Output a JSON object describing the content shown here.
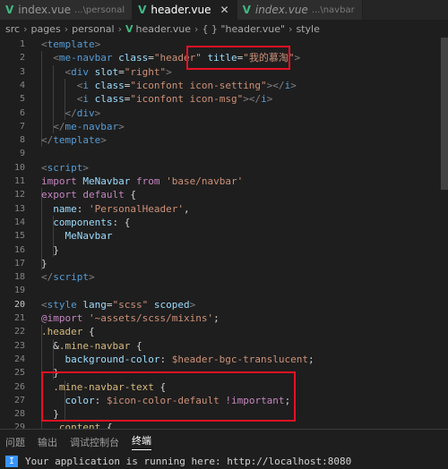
{
  "tabs": [
    {
      "name": "index.vue",
      "hint": "...\\personal",
      "active": false
    },
    {
      "name": "header.vue",
      "hint": "",
      "active": true,
      "close": "✕"
    },
    {
      "name": "index.vue",
      "hint": "...\\navbar",
      "active": false
    }
  ],
  "breadcrumb": [
    "src",
    "pages",
    "personal",
    "header.vue",
    "{ } \"header.vue\"",
    "style"
  ],
  "lines": [
    {
      "n": "1",
      "tokens": [
        [
          "t-punc",
          "<"
        ],
        [
          "t-tag",
          "template"
        ],
        [
          "t-punc",
          ">"
        ]
      ]
    },
    {
      "n": "2",
      "tokens": [
        [
          "t-punc",
          "  <"
        ],
        [
          "t-tag",
          "me-navbar"
        ],
        [
          "t-plain",
          " "
        ],
        [
          "t-attr",
          "class"
        ],
        [
          "t-plain",
          "="
        ],
        [
          "t-str",
          "\"header\""
        ],
        [
          "t-plain",
          " "
        ],
        [
          "t-attr",
          "title"
        ],
        [
          "t-plain",
          "="
        ],
        [
          "t-str",
          "\"我的慕淘\""
        ],
        [
          "t-punc",
          ">"
        ]
      ]
    },
    {
      "n": "3",
      "tokens": [
        [
          "t-punc",
          "    <"
        ],
        [
          "t-tag",
          "div"
        ],
        [
          "t-plain",
          " "
        ],
        [
          "t-attr",
          "slot"
        ],
        [
          "t-plain",
          "="
        ],
        [
          "t-str",
          "\"right\""
        ],
        [
          "t-punc",
          ">"
        ]
      ]
    },
    {
      "n": "4",
      "tokens": [
        [
          "t-punc",
          "      <"
        ],
        [
          "t-tag",
          "i"
        ],
        [
          "t-plain",
          " "
        ],
        [
          "t-attr",
          "class"
        ],
        [
          "t-plain",
          "="
        ],
        [
          "t-str",
          "\"iconfont icon-setting\""
        ],
        [
          "t-punc",
          "></"
        ],
        [
          "t-tag",
          "i"
        ],
        [
          "t-punc",
          ">"
        ]
      ]
    },
    {
      "n": "5",
      "tokens": [
        [
          "t-punc",
          "      <"
        ],
        [
          "t-tag",
          "i"
        ],
        [
          "t-plain",
          " "
        ],
        [
          "t-attr",
          "class"
        ],
        [
          "t-plain",
          "="
        ],
        [
          "t-str",
          "\"iconfont icon-msg\""
        ],
        [
          "t-punc",
          "></"
        ],
        [
          "t-tag",
          "i"
        ],
        [
          "t-punc",
          ">"
        ]
      ]
    },
    {
      "n": "6",
      "tokens": [
        [
          "t-punc",
          "    </"
        ],
        [
          "t-tag",
          "div"
        ],
        [
          "t-punc",
          ">"
        ]
      ]
    },
    {
      "n": "7",
      "tokens": [
        [
          "t-punc",
          "  </"
        ],
        [
          "t-tag",
          "me-navbar"
        ],
        [
          "t-punc",
          ">"
        ]
      ]
    },
    {
      "n": "8",
      "tokens": [
        [
          "t-punc",
          "</"
        ],
        [
          "t-tag",
          "template"
        ],
        [
          "t-punc",
          ">"
        ]
      ]
    },
    {
      "n": "9",
      "tokens": []
    },
    {
      "n": "10",
      "tokens": [
        [
          "t-punc",
          "<"
        ],
        [
          "t-tag",
          "script"
        ],
        [
          "t-punc",
          ">"
        ]
      ]
    },
    {
      "n": "11",
      "tokens": [
        [
          "t-kw",
          "import"
        ],
        [
          "t-plain",
          " "
        ],
        [
          "t-attr",
          "MeNavbar"
        ],
        [
          "t-plain",
          " "
        ],
        [
          "t-kw",
          "from"
        ],
        [
          "t-plain",
          " "
        ],
        [
          "t-str",
          "'base/navbar'"
        ]
      ]
    },
    {
      "n": "12",
      "tokens": [
        [
          "t-kw",
          "export"
        ],
        [
          "t-plain",
          " "
        ],
        [
          "t-kw",
          "default"
        ],
        [
          "t-plain",
          " {"
        ]
      ]
    },
    {
      "n": "13",
      "tokens": [
        [
          "t-prop",
          "  name"
        ],
        [
          "t-plain",
          ": "
        ],
        [
          "t-str",
          "'PersonalHeader'"
        ],
        [
          "t-plain",
          ","
        ]
      ]
    },
    {
      "n": "14",
      "tokens": [
        [
          "t-prop",
          "  components"
        ],
        [
          "t-plain",
          ": {"
        ]
      ]
    },
    {
      "n": "15",
      "tokens": [
        [
          "t-prop",
          "    MeNavbar"
        ]
      ]
    },
    {
      "n": "16",
      "tokens": [
        [
          "t-plain",
          "  }"
        ]
      ]
    },
    {
      "n": "17",
      "tokens": [
        [
          "t-plain",
          "}"
        ]
      ]
    },
    {
      "n": "18",
      "tokens": [
        [
          "t-punc",
          "</"
        ],
        [
          "t-tag",
          "script"
        ],
        [
          "t-punc",
          ">"
        ]
      ]
    },
    {
      "n": "19",
      "tokens": []
    },
    {
      "n": "20",
      "tokens": [
        [
          "t-punc",
          "<"
        ],
        [
          "t-tag",
          "style"
        ],
        [
          "t-plain",
          " "
        ],
        [
          "t-attr",
          "lang"
        ],
        [
          "t-plain",
          "="
        ],
        [
          "t-str",
          "\"scss\""
        ],
        [
          "t-plain",
          " "
        ],
        [
          "t-attr",
          "scoped"
        ],
        [
          "t-punc",
          ">"
        ]
      ]
    },
    {
      "n": "21",
      "tokens": [
        [
          "t-imp",
          "@import"
        ],
        [
          "t-plain",
          " "
        ],
        [
          "t-str",
          "'~assets/scss/mixins'"
        ],
        [
          "t-plain",
          ";"
        ]
      ]
    },
    {
      "n": "22",
      "tokens": [
        [
          "t-sel",
          ".header"
        ],
        [
          "t-plain",
          " {"
        ]
      ]
    },
    {
      "n": "23",
      "tokens": [
        [
          "t-plain",
          "  &"
        ],
        [
          "t-sel",
          ".mine-navbar"
        ],
        [
          "t-plain",
          " {"
        ]
      ]
    },
    {
      "n": "24",
      "tokens": [
        [
          "t-prop",
          "    background-color"
        ],
        [
          "t-plain",
          ": "
        ],
        [
          "t-var",
          "$header-bgc-translucent"
        ],
        [
          "t-plain",
          ";"
        ]
      ]
    },
    {
      "n": "25",
      "tokens": [
        [
          "t-plain",
          "  }"
        ]
      ]
    },
    {
      "n": "26",
      "tokens": [
        [
          "t-sel",
          "  .mine-navbar-text"
        ],
        [
          "t-plain",
          " {"
        ]
      ]
    },
    {
      "n": "27",
      "tokens": [
        [
          "t-prop",
          "    color"
        ],
        [
          "t-plain",
          ": "
        ],
        [
          "t-var",
          "$icon-color-default"
        ],
        [
          "t-plain",
          " "
        ],
        [
          "t-kw",
          "!important"
        ],
        [
          "t-plain",
          ";"
        ]
      ]
    },
    {
      "n": "28",
      "tokens": [
        [
          "t-plain",
          "  }"
        ]
      ]
    },
    {
      "n": "29",
      "tokens": [
        [
          "t-plain",
          "  "
        ],
        [
          "t-sel",
          ".content"
        ],
        [
          "t-plain",
          " {"
        ]
      ]
    }
  ],
  "panel_tabs": [
    {
      "label": "问题",
      "active": false
    },
    {
      "label": "输出",
      "active": false
    },
    {
      "label": "调试控制台",
      "active": false
    },
    {
      "label": "终端",
      "active": true
    }
  ],
  "terminal": {
    "badge": "I",
    "text": "Your application is running here: http://localhost:8080"
  },
  "colors": {
    "highlight_box": "#e81123",
    "vue": "#41b883"
  }
}
